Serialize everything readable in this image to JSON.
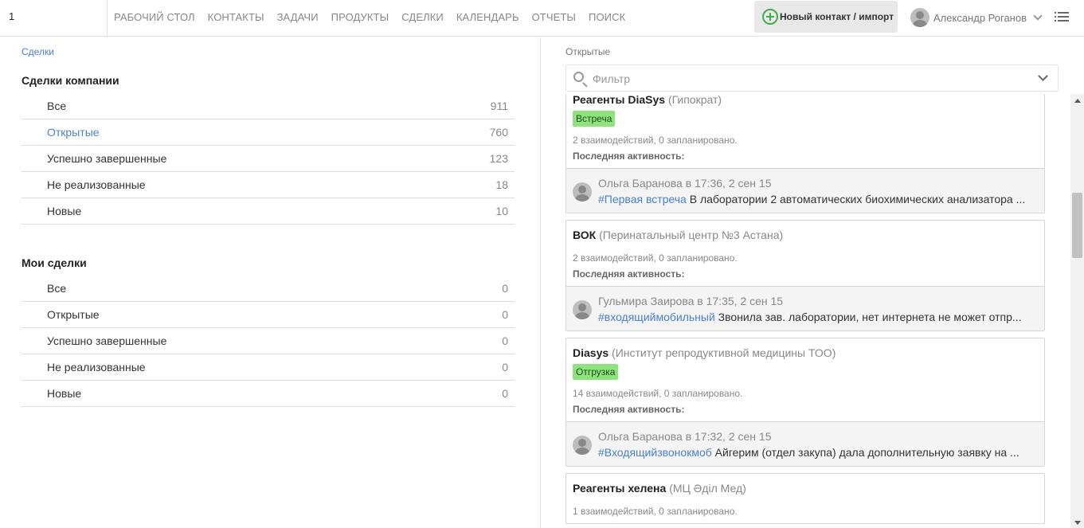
{
  "topbar": {
    "logo_text": "1",
    "nav": [
      "РАБОЧИЙ СТОЛ",
      "КОНТАКТЫ",
      "ЗАДАЧИ",
      "ПРОДУКТЫ",
      "СДЕЛКИ",
      "КАЛЕНДАРЬ",
      "ОТЧЕТЫ",
      "ПОИСК"
    ],
    "new_contact_label": "Новый контакт / импорт",
    "user_name": "Александр Роганов"
  },
  "left": {
    "breadcrumb": "Сделки",
    "company_title": "Сделки компании",
    "company_rows": [
      {
        "label": "Все",
        "count": "911"
      },
      {
        "label": "Открытые",
        "count": "760"
      },
      {
        "label": "Успешно завершенные",
        "count": "123"
      },
      {
        "label": "Не реализованные",
        "count": "18"
      },
      {
        "label": "Новые",
        "count": "10"
      }
    ],
    "my_title": "Мои сделки",
    "my_rows": [
      {
        "label": "Все",
        "count": "0"
      },
      {
        "label": "Открытые",
        "count": "0"
      },
      {
        "label": "Успешно завершенные",
        "count": "0"
      },
      {
        "label": "Не реализованные",
        "count": "0"
      },
      {
        "label": "Новые",
        "count": "0"
      }
    ]
  },
  "right": {
    "title": "Открытые",
    "filter_placeholder": "Фильтр",
    "deals": [
      {
        "name": "Реагенты DiaSys",
        "company": "(Гипократ)",
        "tag": "Встреча",
        "stats": "2 взаимодействий, 0 запланировано.",
        "last_label": "Последняя активность:",
        "author": "Ольга Баранова в 17:36, 2 сен 15",
        "hashtag": "#Первая встреча",
        "message": "В лаборатории 2 автоматических биохимических анализатора ..."
      },
      {
        "name": "ВОК",
        "company": "(Перинатальный центр №3 Астана)",
        "tag": "",
        "stats": "2 взаимодействий, 0 запланировано.",
        "last_label": "Последняя активность:",
        "author": "Гульмира Заирова в 17:35, 2 сен 15",
        "hashtag": "#входящиймобильный",
        "message": "Звонила зав. лаборатории, нет интернета не может отпр..."
      },
      {
        "name": "Diasys",
        "company": "(Институт репродуктивной медицины ТОО)",
        "tag": "Отгрузка",
        "stats": "14 взаимодействий, 0 запланировано.",
        "last_label": "Последняя активность:",
        "author": "Ольга Баранова в 17:32, 2 сен 15",
        "hashtag": "#Входящийзвонокмоб",
        "message": "Айгерим (отдел закупа) дала дополнительную заявку на ..."
      },
      {
        "name": "Реагенты хелена",
        "company": "(МЦ Әділ Мед)",
        "tag": "",
        "stats": "1 взаимодействий, 0 запланировано.",
        "last_label": "",
        "author": "",
        "hashtag": "",
        "message": ""
      }
    ]
  },
  "colors": {
    "accent_link": "#4a7fd1",
    "tag_green": "#8ee37f",
    "plus_green": "#3fae49"
  }
}
